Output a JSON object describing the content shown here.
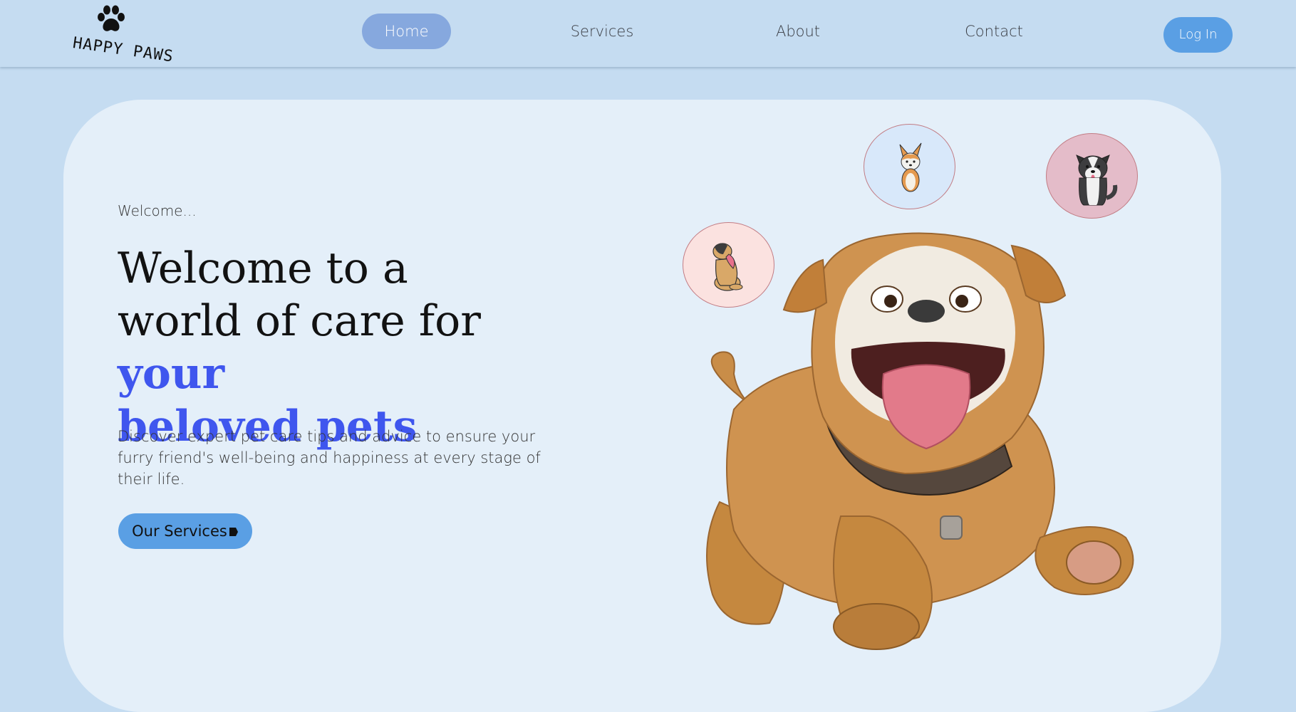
{
  "logo": {
    "text": "HAPPY PAWS",
    "icon": "paw-icon"
  },
  "nav": {
    "items": [
      {
        "label": "Home",
        "active": true
      },
      {
        "label": "Services",
        "active": false
      },
      {
        "label": "About",
        "active": false
      },
      {
        "label": "Contact",
        "active": false
      }
    ],
    "login_label": "Log In"
  },
  "hero": {
    "eyebrow": "Welcome...",
    "headline_plain_1": "Welcome to a",
    "headline_plain_2": "world of care for ",
    "headline_highlight_1": "your",
    "headline_highlight_2": "beloved pets",
    "description": "Discover expert pet care tips and advice to ensure your furry friend's well-being and happiness at every stage of their life.",
    "cta_label": "Our Services",
    "cta_icon": "arrow-right-icon"
  },
  "images": {
    "bubbles": [
      "corgi-puppy-image",
      "husky-puppy-image",
      "pug-puppy-image"
    ],
    "main": "bulldog-image"
  },
  "colors": {
    "background": "#c5dcf1",
    "card": "#e4eff9",
    "accent": "#5a9fe4",
    "nav_active": "#86a8de",
    "highlight": "#3f56ee"
  }
}
